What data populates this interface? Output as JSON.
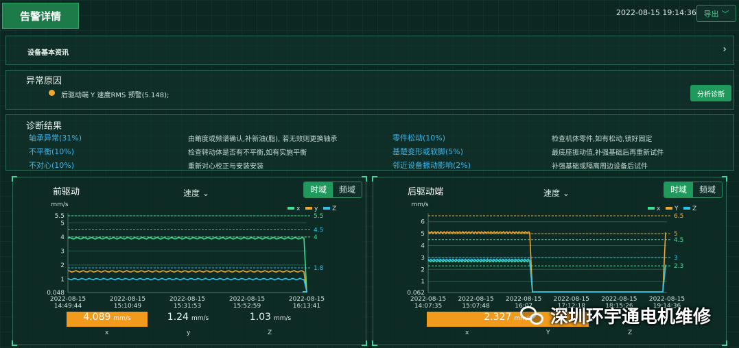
{
  "header": {
    "title": "告警详情",
    "datetime": "2022-08-15 19:14:36",
    "export_label": "导出"
  },
  "basic_info": {
    "title": "设备基本资讯"
  },
  "abnormal": {
    "title": "异常原因",
    "message": "后驱动端 Y 速度RMS 预警(5.148);",
    "analyze_label": "分析诊断"
  },
  "diagnosis": {
    "title": "诊断结果",
    "items": [
      {
        "name": "轴承异常(31%)",
        "advice": "由鲔度或频谱确认,补新油(脂), 若无效则更换轴承"
      },
      {
        "name": "不平衡(10%)",
        "advice": "检查转动体是否有不平衡,如有实施平衡"
      },
      {
        "name": "不对心(10%)",
        "advice": "重新对心校正与安装安装"
      },
      {
        "name": "零件松动(10%)",
        "advice": "检查机体零件,如有松动,锁好固定"
      },
      {
        "name": "基楚变形或软脚(5%)",
        "advice": "最底座振动值,补强基础后再重新试件"
      },
      {
        "name": "邻近设备振动影响(2%)",
        "advice": "补强基础或隔离周边设备后试件"
      }
    ]
  },
  "charts": [
    {
      "title": "前驱动",
      "selector": "速度",
      "tab_time": "时域",
      "tab_freq": "频域",
      "stats": [
        {
          "value": "4.089",
          "unit": "mm/s",
          "label": "x"
        },
        {
          "value": "1.24",
          "unit": "mm/s",
          "label": "y"
        },
        {
          "value": "1.03",
          "unit": "mm/s",
          "label": "Z"
        }
      ]
    },
    {
      "title": "后驱动端",
      "selector": "速度",
      "tab_time": "时域",
      "tab_freq": "频域",
      "stats": [
        {
          "value": "2.327",
          "unit": "mm/s",
          "label": "x"
        },
        {
          "value": "",
          "unit": "",
          "label": "Y"
        },
        {
          "value": "",
          "unit": "",
          "label": "Z"
        }
      ]
    }
  ],
  "chart_data": [
    {
      "type": "line",
      "ylabel": "mm/s",
      "ylim": [
        0.048,
        5.5
      ],
      "yticks": [
        "0.048",
        "1",
        "2",
        "3",
        "4",
        "5",
        "5.5"
      ],
      "x": [
        "2022-08-15 14:49:44",
        "2022-08-15 15:10:49",
        "2022-08-15 15:31:53",
        "2022-08-15 15:52:59",
        "2022-08-15 16:13:41"
      ],
      "legend": [
        "x",
        "y",
        "Z"
      ],
      "series_colors": [
        "#3de08f",
        "#f2a62b",
        "#27c5ee"
      ],
      "series": [
        {
          "name": "x",
          "level": 3.9,
          "end": 0.1
        },
        {
          "name": "y",
          "level": 1.55,
          "end": 0.1
        },
        {
          "name": "Z",
          "level": 1.0,
          "end": 0.1
        }
      ],
      "thresholds": [
        {
          "value": 5.5,
          "label": "5.5",
          "color": "#3de08f"
        },
        {
          "value": 4.5,
          "label": "4.5",
          "color": "#27c5ee"
        },
        {
          "value": 4,
          "label": "4",
          "color": "#3de08f"
        },
        {
          "value": 1.8,
          "label": "1.8",
          "color": "#27c5ee"
        }
      ]
    },
    {
      "type": "line",
      "ylabel": "mm/s",
      "ylim": [
        0.062,
        6.5
      ],
      "yticks": [
        "0.062",
        "1",
        "2",
        "3",
        "4",
        "5",
        "6"
      ],
      "x": [
        "2022-08-15 14:07:35",
        "2022-08-15 15:07:48",
        "2022-08-15 16:07",
        "2022-08-15 17:12:18",
        "2022-08-15 18:15:26",
        "2022-08-15 19:14:36"
      ],
      "legend": [
        "x",
        "Y",
        "Z"
      ],
      "series_colors": [
        "#3de08f",
        "#f2a62b",
        "#27c5ee"
      ],
      "series": [
        {
          "name": "x",
          "level": 2.7,
          "end": 2.3
        },
        {
          "name": "Y",
          "level": 5.1,
          "end": 5.1
        },
        {
          "name": "Z",
          "level": 2.8,
          "end": 2.4
        }
      ],
      "thresholds": [
        {
          "value": 6.5,
          "label": "6.5",
          "color": "#f2a62b"
        },
        {
          "value": 5,
          "label": "5",
          "color": "#f2a62b"
        },
        {
          "value": 4.5,
          "label": "4.5",
          "color": "#3de08f"
        },
        {
          "value": 3,
          "label": "3",
          "color": "#27c5ee"
        },
        {
          "value": 2.3,
          "label": "2.3",
          "color": "#3de08f"
        }
      ]
    }
  ],
  "watermark": "深圳环宇通电机维修"
}
